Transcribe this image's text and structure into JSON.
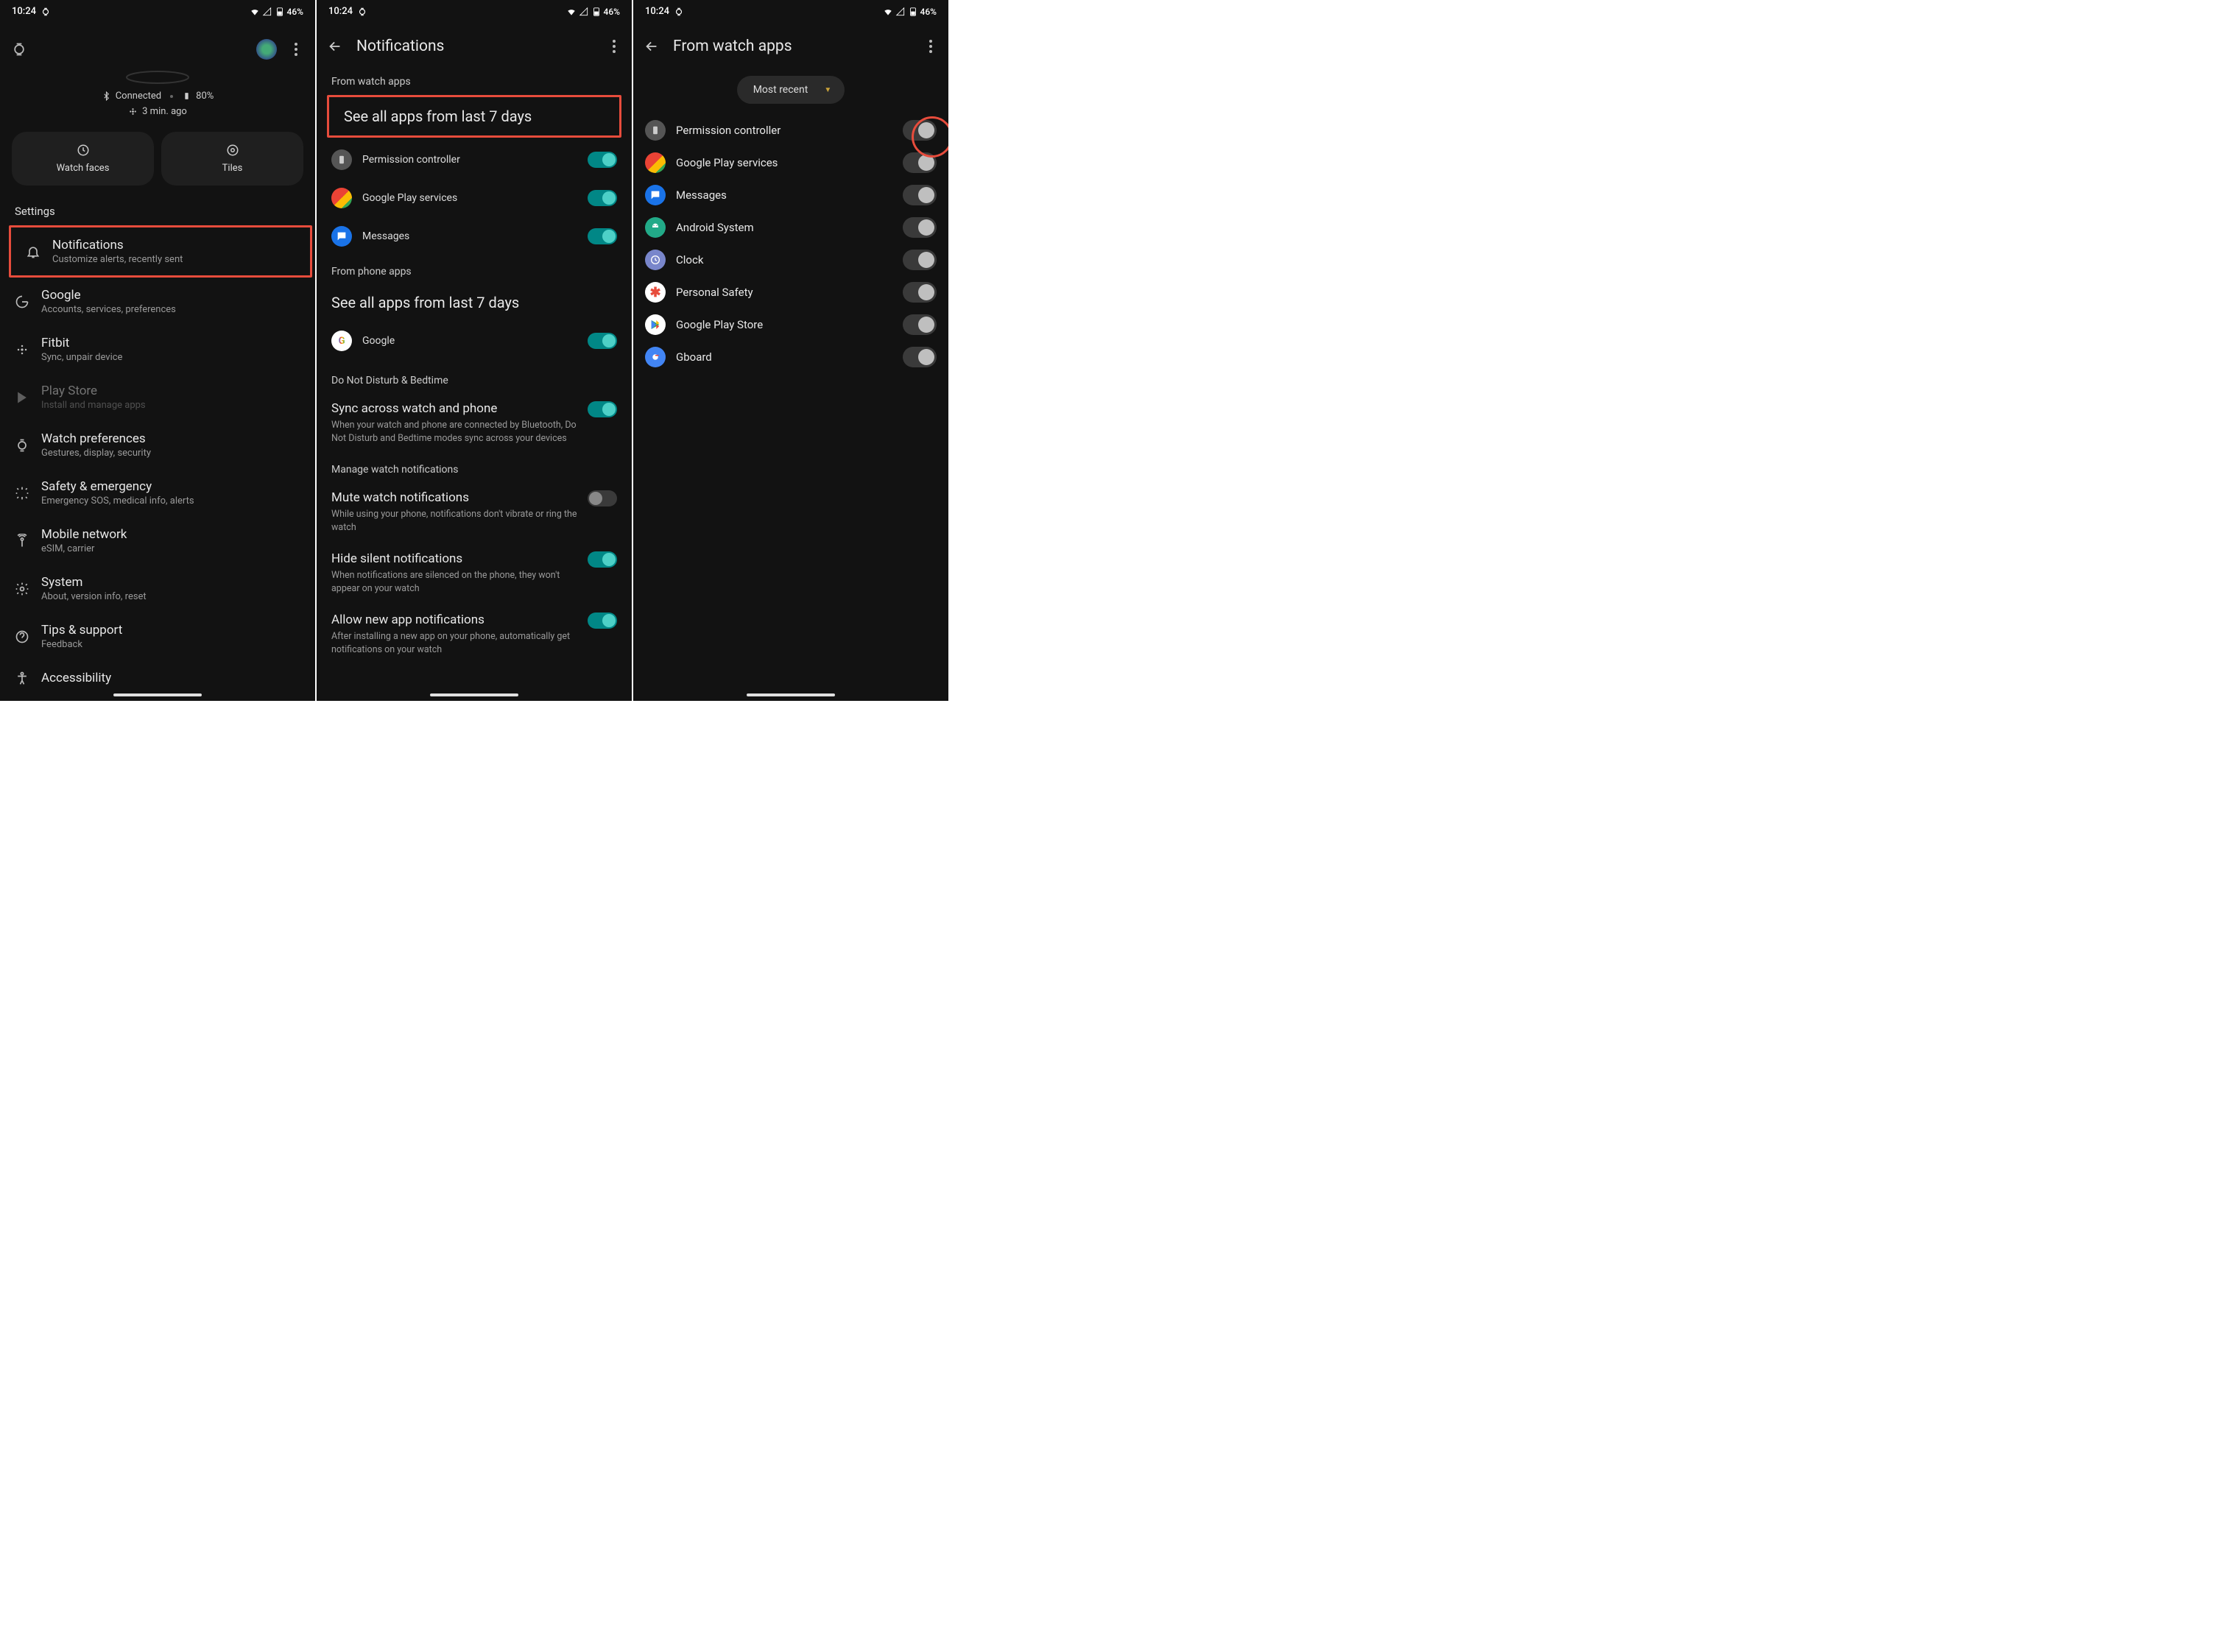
{
  "status": {
    "time": "10:24",
    "battery": "46%"
  },
  "panel1": {
    "connected": "Connected",
    "battery": "80%",
    "last_sync": "3 min. ago",
    "chip_watchfaces": "Watch faces",
    "chip_tiles": "Tiles",
    "settings_header": "Settings",
    "items": [
      {
        "title": "Notifications",
        "subtitle": "Customize alerts, recently sent"
      },
      {
        "title": "Google",
        "subtitle": "Accounts, services, preferences"
      },
      {
        "title": "Fitbit",
        "subtitle": "Sync, unpair device"
      },
      {
        "title": "Play Store",
        "subtitle": "Install and manage apps"
      },
      {
        "title": "Watch preferences",
        "subtitle": "Gestures, display, security"
      },
      {
        "title": "Safety & emergency",
        "subtitle": "Emergency SOS, medical info, alerts"
      },
      {
        "title": "Mobile network",
        "subtitle": "eSIM, carrier"
      },
      {
        "title": "System",
        "subtitle": "About, version info, reset"
      },
      {
        "title": "Tips & support",
        "subtitle": "Feedback"
      },
      {
        "title": "Accessibility",
        "subtitle": ""
      }
    ]
  },
  "panel2": {
    "title": "Notifications",
    "sub_watch": "From watch apps",
    "see_all": "See all apps from last 7 days",
    "apps_watch": [
      {
        "name": "Permission controller"
      },
      {
        "name": "Google Play services"
      },
      {
        "name": "Messages"
      }
    ],
    "sub_phone": "From phone apps",
    "apps_phone": [
      {
        "name": "Google"
      }
    ],
    "sub_dnd": "Do Not Disturb & Bedtime",
    "sync_title": "Sync across watch and phone",
    "sync_desc": "When your watch and phone are connected by Bluetooth, Do Not Disturb and Bedtime modes sync across your devices",
    "sub_manage": "Manage watch notifications",
    "mute_title": "Mute watch notifications",
    "mute_desc": "While using your phone, notifications don't vibrate or ring the watch",
    "hide_title": "Hide silent notifications",
    "hide_desc": "When notifications are silenced on the phone, they won't appear on your watch",
    "allow_title": "Allow new app notifications",
    "allow_desc": "After installing a new app on your phone, automatically get notifications on your watch"
  },
  "panel3": {
    "title": "From watch apps",
    "filter": "Most recent",
    "apps": [
      {
        "name": "Permission controller"
      },
      {
        "name": "Google Play services"
      },
      {
        "name": "Messages"
      },
      {
        "name": "Android System"
      },
      {
        "name": "Clock"
      },
      {
        "name": "Personal Safety"
      },
      {
        "name": "Google Play Store"
      },
      {
        "name": "Gboard"
      }
    ]
  }
}
